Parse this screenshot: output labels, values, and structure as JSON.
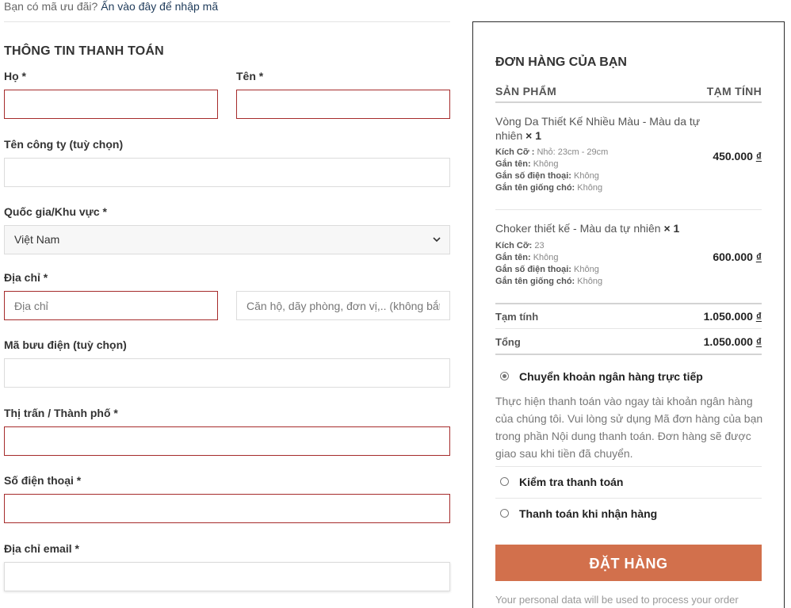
{
  "coupon": {
    "prefix": "Bạn có mã ưu đãi?",
    "link": "Ấn vào đây để nhập mã"
  },
  "billing": {
    "title": "THÔNG TIN THANH TOÁN",
    "last_name": {
      "label": "Họ *",
      "value": ""
    },
    "first_name": {
      "label": "Tên *",
      "value": ""
    },
    "company": {
      "label": "Tên công ty (tuỳ chọn)",
      "value": ""
    },
    "country": {
      "label": "Quốc gia/Khu vực *",
      "value": "Việt Nam"
    },
    "address": {
      "label": "Địa chỉ *",
      "placeholder": "Địa chỉ",
      "placeholder2": "Căn hộ, dãy phòng, đơn vị,.. (không bắt buộc)"
    },
    "postcode": {
      "label": "Mã bưu điện (tuỳ chọn)",
      "value": ""
    },
    "city": {
      "label": "Thị trấn / Thành phố *",
      "value": ""
    },
    "phone": {
      "label": "Số điện thoại *",
      "value": ""
    },
    "email": {
      "label": "Địa chỉ email *",
      "value": ""
    }
  },
  "order": {
    "title": "ĐƠN HÀNG CỦA BẠN",
    "col_product": "SẢN PHẨM",
    "col_subtotal": "TẠM TÍNH",
    "items": [
      {
        "name": "Vòng Da Thiết Kế Nhiều Màu - Màu da tự nhiên",
        "qty": "× 1",
        "meta": [
          {
            "key": "Kích Cỡ :",
            "value": "Nhỏ: 23cm - 29cm"
          },
          {
            "key": "Gắn tên:",
            "value": "Không"
          },
          {
            "key": "Gắn số điện thoại:",
            "value": "Không"
          },
          {
            "key": "Gắn tên giống chó:",
            "value": "Không"
          }
        ],
        "price": "450.000",
        "currency": "₫"
      },
      {
        "name": "Choker thiết kế - Màu da tự nhiên",
        "qty": "× 1",
        "meta": [
          {
            "key": "Kích Cỡ:",
            "value": "23"
          },
          {
            "key": "Gắn tên:",
            "value": "Không"
          },
          {
            "key": "Gắn số điện thoại:",
            "value": "Không"
          },
          {
            "key": "Gắn tên giống chó:",
            "value": "Không"
          }
        ],
        "price": "600.000",
        "currency": "₫"
      }
    ],
    "subtotal_label": "Tạm tính",
    "subtotal_value": "1.050.000",
    "total_label": "Tổng",
    "total_value": "1.050.000",
    "currency": "₫"
  },
  "payment": {
    "methods": [
      {
        "label": "Chuyển khoản ngân hàng trực tiếp",
        "selected": true
      },
      {
        "label": "Kiểm tra thanh toán",
        "selected": false
      },
      {
        "label": "Thanh toán khi nhận hàng",
        "selected": false
      }
    ],
    "bacs_description": "Thực hiện thanh toán vào ngay tài khoản ngân hàng của chúng tôi. Vui lòng sử dụng Mã đơn hàng của bạn trong phần Nội dung thanh toán. Đơn hàng sẽ được giao sau khi tiền đã chuyển."
  },
  "place_order": "ĐẶT HÀNG",
  "privacy_cut": "Your personal data will be used to process your order"
}
